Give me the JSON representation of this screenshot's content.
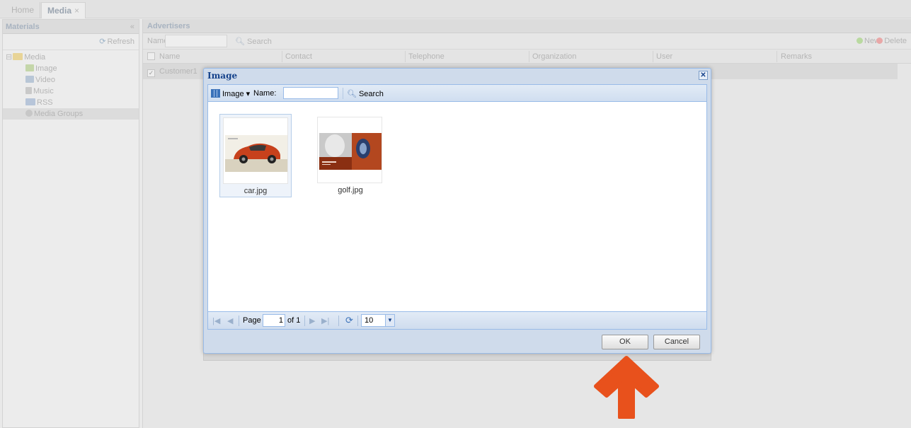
{
  "tabs": [
    {
      "label": "Home"
    },
    {
      "label": "Media",
      "close": "×"
    }
  ],
  "left_panel": {
    "title": "Materials",
    "collapse_glyph": "«",
    "refresh_label": "Refresh",
    "tree": {
      "root": "Media",
      "children": [
        "Image",
        "Video",
        "Music",
        "RSS",
        "Media Groups"
      ]
    }
  },
  "right_panel": {
    "title": "Advertisers",
    "filter_label": "Name:",
    "search_label": "Search",
    "new_label": "New",
    "delete_label": "Delete",
    "columns": [
      "Name",
      "Contact",
      "Telephone",
      "Organization",
      "User",
      "Remarks"
    ],
    "rows": [
      {
        "name": "Customer1"
      }
    ]
  },
  "dialog": {
    "title": "Image",
    "close_glyph": "✕",
    "type_dropdown": "Image ▾",
    "name_label": "Name:",
    "name_value": "",
    "search_label": "Search",
    "items": [
      {
        "filename": "car.jpg",
        "selected": true
      },
      {
        "filename": "golf.jpg",
        "selected": false
      }
    ],
    "pager": {
      "page_label": "Page",
      "page_value": "1",
      "of_label": "of 1",
      "page_size": "10"
    },
    "ok_label": "OK",
    "cancel_label": "Cancel"
  },
  "annotation": {
    "arrow_color": "#e8511c"
  }
}
